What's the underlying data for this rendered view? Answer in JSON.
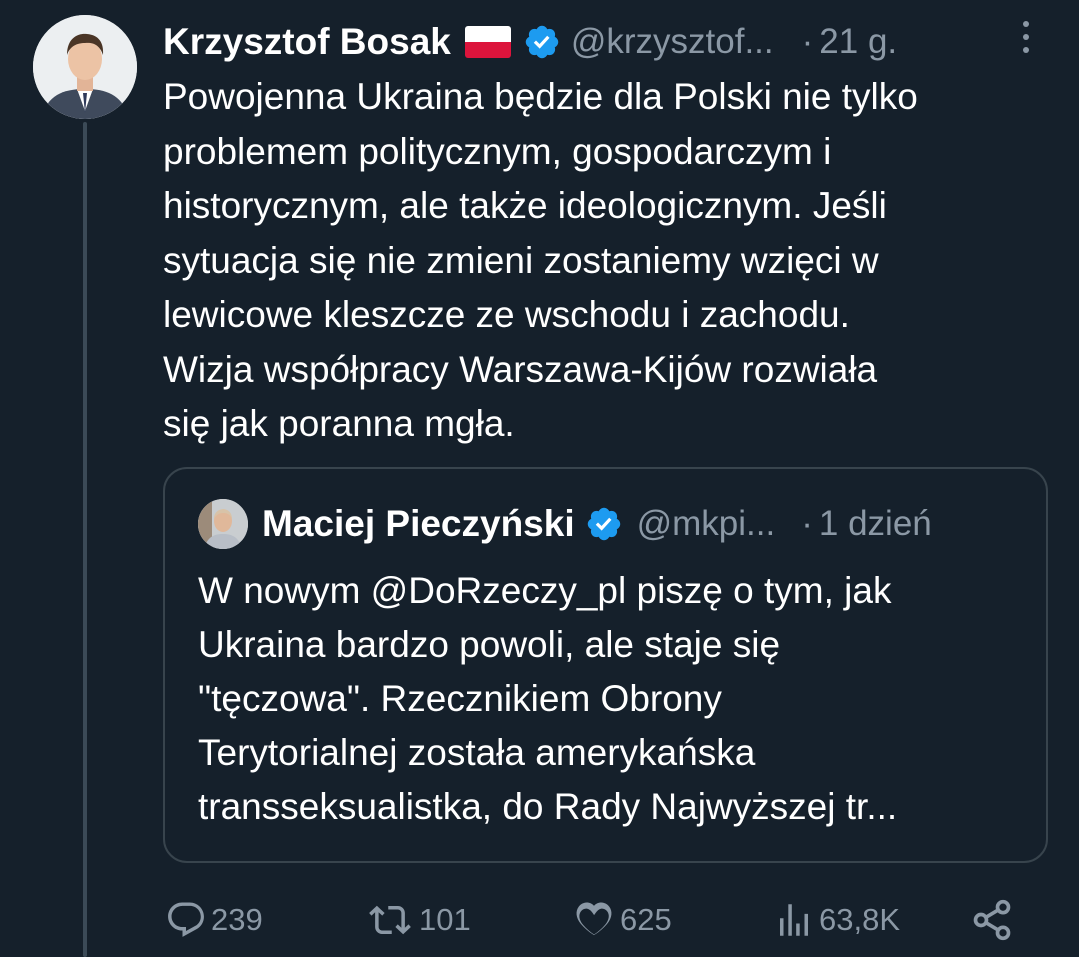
{
  "tweet": {
    "author": {
      "name": "Krzysztof Bosak",
      "handle": "@krzysztof...",
      "avatar_icon": "profile-photo",
      "flag_icon": "poland-flag"
    },
    "time": "21 g.",
    "text": "Powojenna Ukraina będzie dla Polski nie tylko\nproblemem politycznym, gospodarczym i\nhistorycznym, ale także ideologicznym. Jeśli\nsytuacja się nie zmieni zostaniemy wzięci w\nlewicowe kleszcze ze wschodu i zachodu.\nWizja współpracy Warszawa-Kijów rozwiała\nsię jak poranna mgła."
  },
  "quote": {
    "author": {
      "name": "Maciej Pieczyński",
      "handle": "@mkpi...",
      "avatar_icon": "profile-photo"
    },
    "time": "1 dzień",
    "text": "W nowym @DoRzeczy_pl piszę o tym, jak\nUkraina bardzo powoli, ale staje się\n\"tęczowa\". Rzecznikiem Obrony\nTerytorialnej została amerykańska\ntransseksualistka, do Rady Najwyższej tr..."
  },
  "actions": {
    "replies": "239",
    "retweets": "101",
    "likes": "625",
    "views": "63,8K"
  },
  "colors": {
    "background": "#15202b",
    "muted_text": "#8b98a5",
    "verified_blue": "#1d9bf0",
    "border": "#38444d"
  }
}
